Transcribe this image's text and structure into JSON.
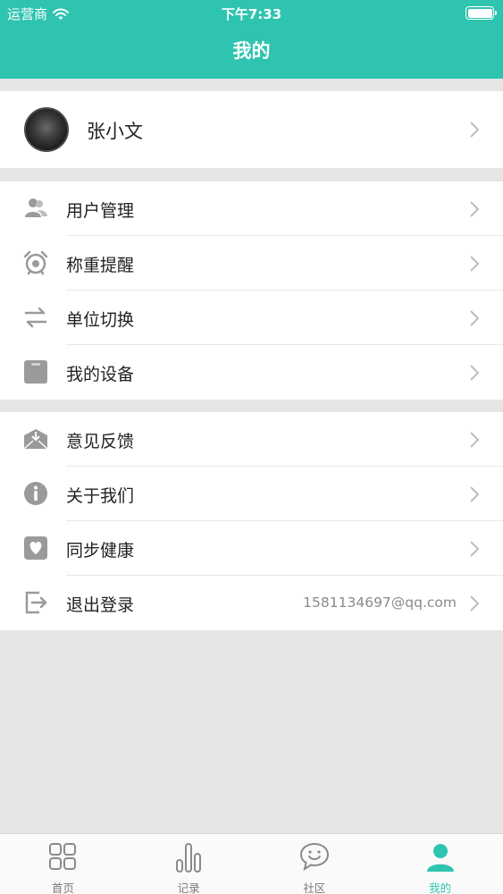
{
  "status_bar": {
    "carrier": "运营商",
    "time": "下午7:33"
  },
  "nav": {
    "title": "我的"
  },
  "profile": {
    "name": "张小文"
  },
  "menu_group1": [
    {
      "label": "用户管理",
      "icon": "users-icon"
    },
    {
      "label": "称重提醒",
      "icon": "alarm-clock-icon"
    },
    {
      "label": "单位切换",
      "icon": "swap-arrows-icon"
    },
    {
      "label": "我的设备",
      "icon": "scale-device-icon"
    }
  ],
  "menu_group2": [
    {
      "label": "意见反馈",
      "icon": "feedback-envelope-icon"
    },
    {
      "label": "关于我们",
      "icon": "info-icon"
    },
    {
      "label": "同步健康",
      "icon": "health-heart-icon"
    },
    {
      "label": "退出登录",
      "icon": "logout-icon",
      "extra": "1581134697@qq.com"
    }
  ],
  "tabs": [
    {
      "label": "首页",
      "icon": "grid-icon",
      "active": false
    },
    {
      "label": "记录",
      "icon": "bar-chart-icon",
      "active": false
    },
    {
      "label": "社区",
      "icon": "chat-bubble-icon",
      "active": false
    },
    {
      "label": "我的",
      "icon": "person-icon",
      "active": true
    }
  ],
  "colors": {
    "accent": "#2ec4b0",
    "background": "#e6e6e6",
    "icon_gray": "#9a9a9a"
  }
}
